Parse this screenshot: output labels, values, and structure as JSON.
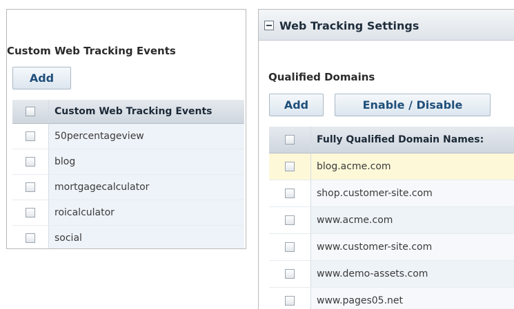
{
  "events_panel": {
    "title": "Custom Web Tracking Events",
    "add_label": "Add",
    "column_header": "Custom Web Tracking Events",
    "rows": [
      "50percentageview",
      "blog",
      "mortgagecalculator",
      "roicalculator",
      "social"
    ]
  },
  "settings_panel": {
    "header_title": "Web Tracking Settings",
    "section_title": "Qualified Domains",
    "add_label": "Add",
    "toggle_label": "Enable / Disable",
    "column_header": "Fully Qualified Domain Names:",
    "rows": [
      "blog.acme.com",
      "shop.customer-site.com",
      "www.acme.com",
      "www.customer-site.com",
      "www.demo-assets.com",
      "www.pages05.net"
    ]
  }
}
